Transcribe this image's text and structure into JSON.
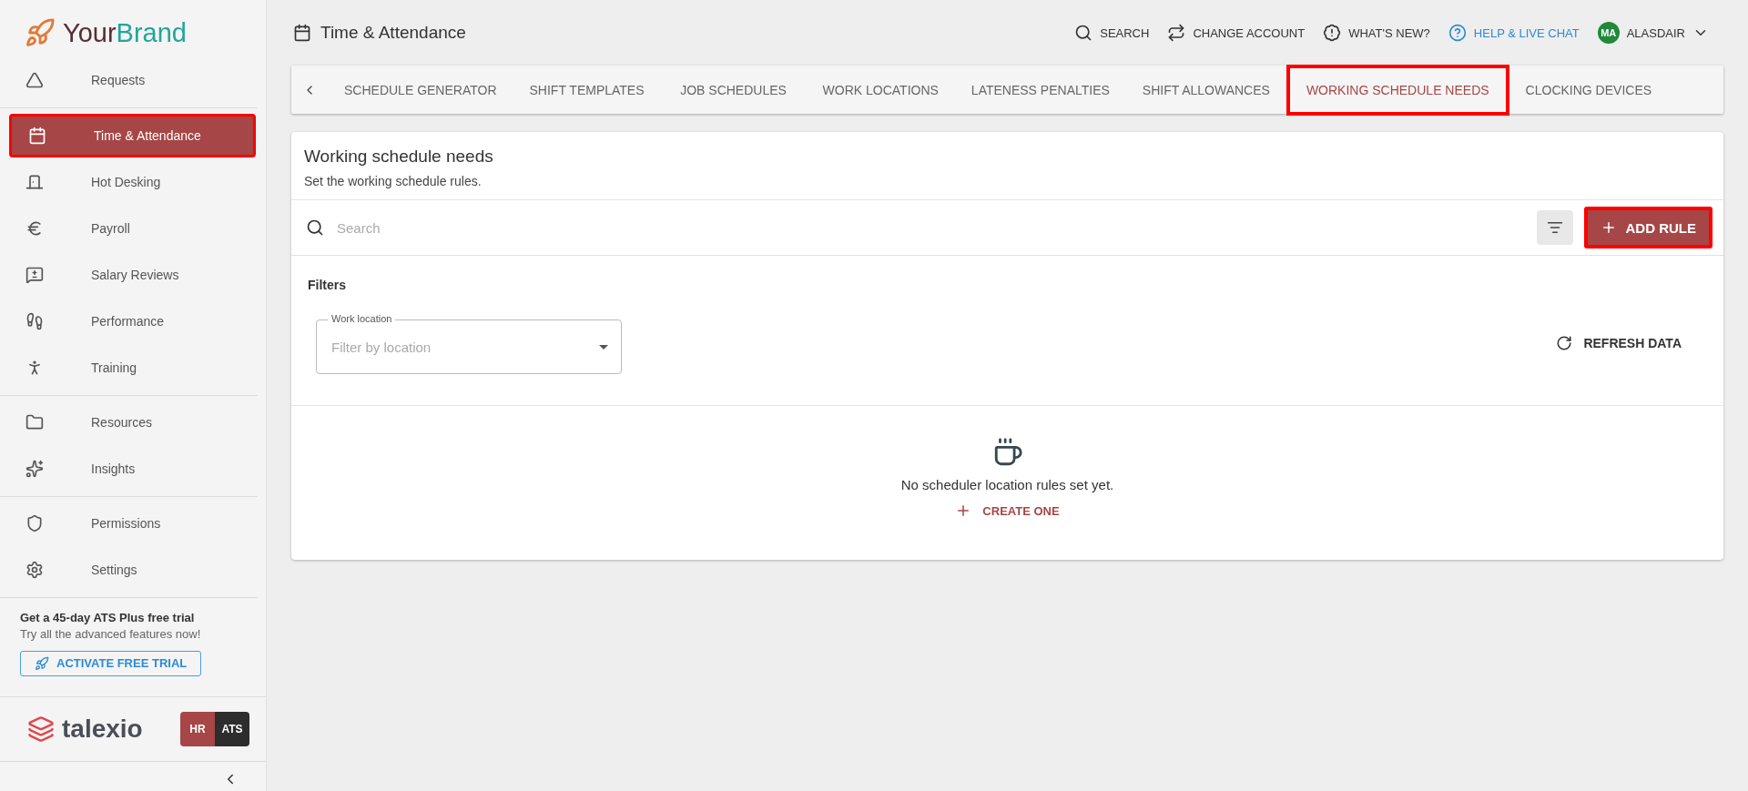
{
  "brand": {
    "name_part1": "Your",
    "name_part2": "Brand"
  },
  "sidebar": {
    "groups": [
      [
        {
          "label": "Requests",
          "selected": false,
          "highlighted": false
        }
      ],
      [
        {
          "label": "Time & Attendance",
          "selected": true,
          "highlighted": true
        },
        {
          "label": "Hot Desking",
          "selected": false,
          "highlighted": false
        },
        {
          "label": "Payroll",
          "selected": false,
          "highlighted": false
        },
        {
          "label": "Salary Reviews",
          "selected": false,
          "highlighted": false
        },
        {
          "label": "Performance",
          "selected": false,
          "highlighted": false
        },
        {
          "label": "Training",
          "selected": false,
          "highlighted": false
        }
      ],
      [
        {
          "label": "Resources",
          "selected": false,
          "highlighted": false
        },
        {
          "label": "Insights",
          "selected": false,
          "highlighted": false
        }
      ],
      [
        {
          "label": "Permissions",
          "selected": false,
          "highlighted": false
        },
        {
          "label": "Settings",
          "selected": false,
          "highlighted": false
        }
      ]
    ]
  },
  "promo": {
    "title": "Get a 45-day ATS Plus free trial",
    "subtitle": "Try all the advanced features now!",
    "button": "ACTIVATE FREE TRIAL"
  },
  "footer": {
    "logo": "talexio",
    "switch": [
      {
        "label": "HR",
        "selected": true
      },
      {
        "label": "ATS",
        "selected": false
      }
    ]
  },
  "header": {
    "title": "Time & Attendance",
    "actions": [
      {
        "label": "SEARCH",
        "kind": "plain"
      },
      {
        "label": "CHANGE ACCOUNT",
        "kind": "plain"
      },
      {
        "label": "WHAT'S NEW?",
        "kind": "plain"
      },
      {
        "label": "HELP & LIVE CHAT",
        "kind": "link"
      }
    ],
    "user": {
      "initials": "MA",
      "name": "ALASDAIR"
    }
  },
  "tabs": [
    {
      "label": "SCHEDULE GENERATOR",
      "selected": false,
      "highlighted": false
    },
    {
      "label": "SHIFT TEMPLATES",
      "selected": false,
      "highlighted": false
    },
    {
      "label": "JOB SCHEDULES",
      "selected": false,
      "highlighted": false
    },
    {
      "label": "WORK LOCATIONS",
      "selected": false,
      "highlighted": false
    },
    {
      "label": "LATENESS PENALTIES",
      "selected": false,
      "highlighted": false
    },
    {
      "label": "SHIFT ALLOWANCES",
      "selected": false,
      "highlighted": false
    },
    {
      "label": "WORKING SCHEDULE NEEDS",
      "selected": true,
      "highlighted": true
    },
    {
      "label": "CLOCKING DEVICES",
      "selected": false,
      "highlighted": false
    }
  ],
  "card": {
    "title": "Working schedule needs",
    "subtitle": "Set the working schedule rules.",
    "search": {
      "placeholder": "Search"
    },
    "add_button": {
      "label": "ADD RULE",
      "highlighted": true
    },
    "filters": {
      "title": "Filters",
      "select": {
        "label": "Work location",
        "placeholder": "Filter by location"
      },
      "refresh": "REFRESH DATA"
    },
    "empty": {
      "message": "No scheduler location rules set yet.",
      "action": "CREATE ONE"
    }
  }
}
